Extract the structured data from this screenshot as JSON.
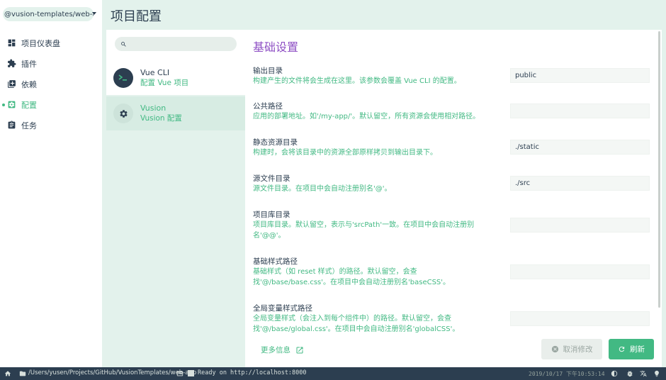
{
  "app": {
    "title": "项目配置"
  },
  "project_selector": {
    "value": "@vusion-templates/web-app"
  },
  "nav": {
    "items": [
      {
        "label": "项目仪表盘",
        "icon": "dashboard-icon",
        "active": false
      },
      {
        "label": "插件",
        "icon": "puzzle-icon",
        "active": false
      },
      {
        "label": "依赖",
        "icon": "library-icon",
        "active": false
      },
      {
        "label": "配置",
        "icon": "settings-applications-icon",
        "active": true
      },
      {
        "label": "任务",
        "icon": "assignment-icon",
        "active": false
      }
    ]
  },
  "config_list": {
    "search": {
      "placeholder": "",
      "value": ""
    },
    "items": [
      {
        "name": "Vue CLI",
        "description": "配置 Vue 项目",
        "icon": "vue-cli-icon",
        "selected": false
      },
      {
        "name": "Vusion",
        "description": "Vusion 配置",
        "icon": "gear-icon",
        "selected": true
      }
    ]
  },
  "section": {
    "title": "基础设置"
  },
  "fields": [
    {
      "label": "输出目录",
      "description": "构建产生的文件将会生成在这里。该参数会覆盖 Vue CLI 的配置。",
      "value": "public"
    },
    {
      "label": "公共路径",
      "description": "应用的部署地址。如'/my-app/'。默认留空，所有资源会使用相对路径。",
      "value": ""
    },
    {
      "label": "静态资源目录",
      "description": "构建时，会将该目录中的资源全部原样拷贝到输出目录下。",
      "value": "./static"
    },
    {
      "label": "源文件目录",
      "description": "源文件目录。在项目中会自动注册别名'@'。",
      "value": "./src"
    },
    {
      "label": "项目库目录",
      "description": "项目库目录。默认留空，表示与'srcPath'一致。在项目中会自动注册别名'@@'。",
      "value": ""
    },
    {
      "label": "基础样式路径",
      "description": "基础样式（如 reset 样式）的路径。默认留空，会查找'@/base/base.css'。在项目中会自动注册别名'baseCSS'。",
      "value": ""
    },
    {
      "label": "全局变量样式路径",
      "description": "全局变量样式（会注入到每个组件中）的路径。默认留空，会查找'@/base/global.css'。在项目中会自动注册别名'globalCSS'。",
      "value": ""
    }
  ],
  "footer": {
    "more_info": "更多信息",
    "cancel_label": "取消修改",
    "refresh_label": "刷新"
  },
  "statusbar": {
    "path": "/Users/yusen/Projects/GitHub/VusionTemplates/web-app",
    "log": "Ready on http://localhost:8000",
    "time": "2019/10/17 下午10:53:14"
  },
  "colors": {
    "accent": "#42b983",
    "dark": "#2c3e50",
    "section_title": "#8e4fc4",
    "background": "#e3f2ec"
  }
}
